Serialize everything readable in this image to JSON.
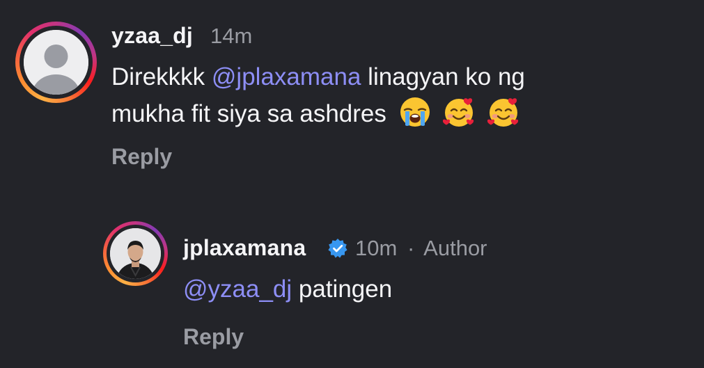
{
  "comments": [
    {
      "username": "yzaa_dj",
      "time": "14m",
      "text_prefix": "Direkkkk ",
      "mention": "@jplaxamana",
      "text_line1_suffix": " linagyan ko ng",
      "text_line2": "mukha fit siya sa ashdres ",
      "emojis": [
        "loudly-crying-face",
        "smiling-face-with-hearts",
        "smiling-face-with-hearts"
      ],
      "reply_label": "Reply"
    },
    {
      "username": "jplaxamana",
      "verified": true,
      "time": "10m",
      "separator": "·",
      "author_badge": "Author",
      "mention": "@yzaa_dj",
      "text": " patingen",
      "reply_label": "Reply"
    }
  ],
  "colors": {
    "background": "#232429",
    "text": "#f5f5f7",
    "muted": "#9a9ca3",
    "mention": "#8d8ef5",
    "verified": "#3897f0"
  }
}
